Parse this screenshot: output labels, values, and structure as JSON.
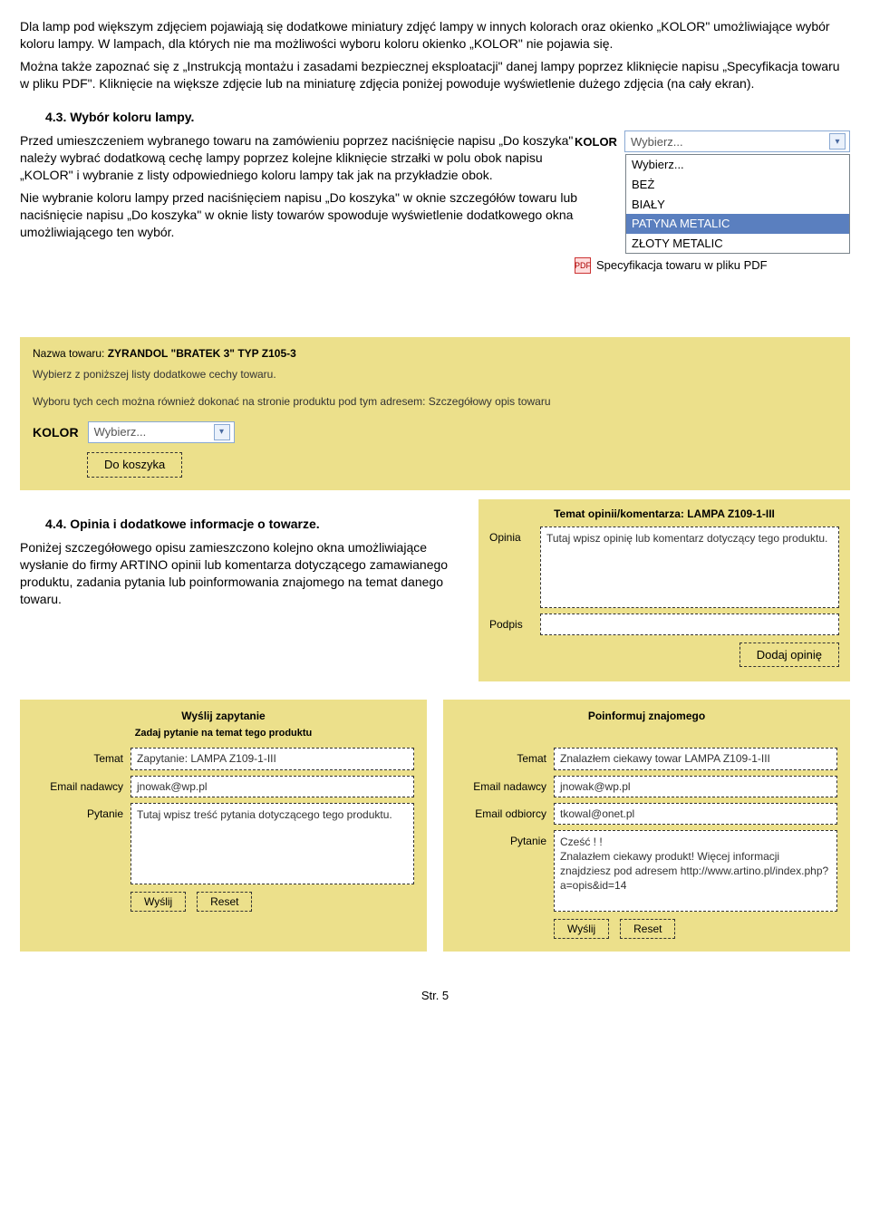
{
  "intro": {
    "p1": "Dla lamp pod większym zdjęciem pojawiają się dodatkowe miniatury zdjęć lampy w innych kolorach oraz okienko „KOLOR\" umożliwiające wybór koloru lampy. W lampach, dla których nie ma możliwości wyboru koloru okienko „KOLOR\" nie pojawia się.",
    "p2": "Można także zapoznać się z „Instrukcją montażu i zasadami bezpiecznej eksploatacji\" danej lampy poprzez kliknięcie napisu „Specyfikacja towaru w pliku PDF\". Kliknięcie na większe zdjęcie lub na miniaturę zdjęcia poniżej powoduje wyświetlenie dużego zdjęcia (na cały ekran)."
  },
  "sec43": {
    "head": "4.3. Wybór koloru lampy.",
    "p1": "Przed umieszczeniem wybranego towaru na zamówieniu poprzez naciśnięcie napisu „Do koszyka\" należy wybrać dodatkową cechę lampy poprzez kolejne kliknięcie strzałki w polu obok napisu „KOLOR\" i wybranie z listy odpowiedniego koloru lampy tak jak na przykładzie obok.",
    "p2": "Nie wybranie koloru lampy przed naciśnięciem napisu „Do koszyka\" w oknie szczegółów towaru lub naciśnięcie napisu „Do koszyka\"  w oknie listy towarów spowoduje wyświetlenie dodatkowego okna umożliwiającego ten wybór."
  },
  "kolor": {
    "label": "KOLOR",
    "placeholder": "Wybierz...",
    "options": [
      "Wybierz...",
      "BEŻ",
      "BIAŁY",
      "PATYNA METALIC",
      "ZŁOTY METALIC"
    ],
    "selected": "PATYNA METALIC",
    "spec_link": "Specyfikacja towaru w pliku PDF"
  },
  "panel1": {
    "name_line_label": "Nazwa towaru:",
    "name_line_value": "ZYRANDOL \"BRATEK 3\" TYP Z105-3",
    "hint1": "Wybierz z poniższej listy dodatkowe cechy towaru.",
    "hint2": "Wyboru tych cech można również dokonać na stronie produktu pod tym adresem: Szczegółowy opis towaru",
    "kolor_label": "KOLOR",
    "select_placeholder": "Wybierz...",
    "cart_btn": "Do koszyka"
  },
  "sec44": {
    "head": "4.4. Opinia i dodatkowe informacje o towarze.",
    "p1": "Poniżej szczegółowego opisu zamieszczono kolejno okna umożliwiające wysłanie do firmy ARTINO opinii lub komentarza dotyczącego zamawianego produktu, zadania pytania lub poinformowania znajomego na temat danego towaru."
  },
  "opinion": {
    "title": "Temat opinii/komentarza: LAMPA Z109-1-III",
    "op_label": "Opinia",
    "op_placeholder": "Tutaj wpisz opinię lub komentarz dotyczący tego produktu.",
    "sign_label": "Podpis",
    "sign_value": "",
    "add_btn": "Dodaj opinię"
  },
  "inquiry": {
    "head": "Wyślij zapytanie",
    "sub": "Zadaj pytanie na temat tego produktu",
    "subject_label": "Temat",
    "subject_value": "Zapytanie: LAMPA Z109-1-III",
    "sender_label": "Email nadawcy",
    "sender_value": "jnowak@wp.pl",
    "q_label": "Pytanie",
    "q_value": "Tutaj wpisz treść pytania dotyczącego tego produktu.",
    "send_btn": "Wyślij",
    "reset_btn": "Reset"
  },
  "inform": {
    "head": "Poinformuj znajomego",
    "subject_label": "Temat",
    "subject_value": "Znalazłem ciekawy towar LAMPA Z109-1-III",
    "sender_label": "Email nadawcy",
    "sender_value": "jnowak@wp.pl",
    "recip_label": "Email odbiorcy",
    "recip_value": "tkowal@onet.pl",
    "q_label": "Pytanie",
    "q_value": "Cześć ! !\nZnalazłem ciekawy produkt! Więcej informacji znajdziesz pod adresem http://www.artino.pl/index.php?a=opis&id=14",
    "send_btn": "Wyślij",
    "reset_btn": "Reset"
  },
  "footer": "Str. 5"
}
